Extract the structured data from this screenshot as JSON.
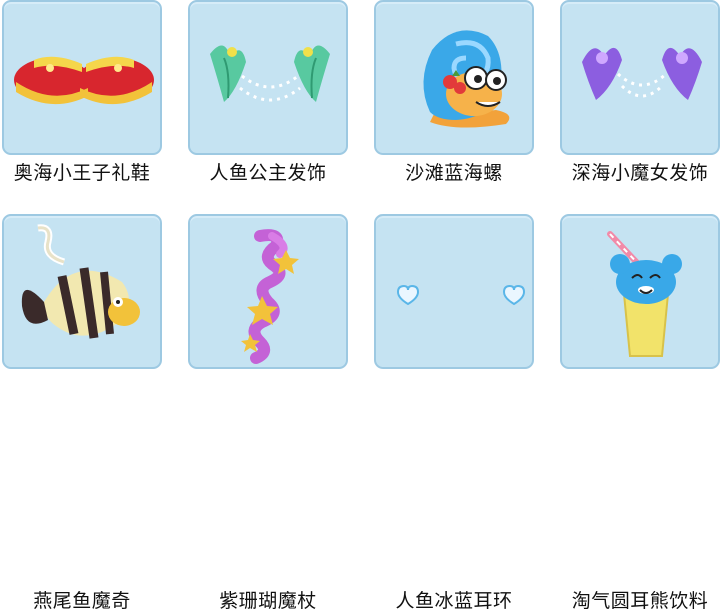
{
  "items": [
    {
      "label": "奥海小王子礼鞋",
      "icon": "red-shoes-icon"
    },
    {
      "label": "人鱼公主发饰",
      "icon": "seaweed-hair-ornament-icon"
    },
    {
      "label": "沙滩蓝海螺",
      "icon": "blue-snail-icon"
    },
    {
      "label": "深海小魔女发饰",
      "icon": "purple-coral-hair-ornament-icon"
    },
    {
      "label": "燕尾鱼魔奇",
      "icon": "striped-fish-icon"
    },
    {
      "label": "紫珊瑚魔杖",
      "icon": "coral-wand-icon"
    },
    {
      "label": "人鱼冰蓝耳环",
      "icon": "heart-earrings-icon"
    },
    {
      "label": "淘气圆耳熊饮料",
      "icon": "bear-cup-drink-icon"
    }
  ],
  "colors": {
    "tile_bg": "#c5e3f2",
    "tile_border": "#9dc9e2"
  }
}
